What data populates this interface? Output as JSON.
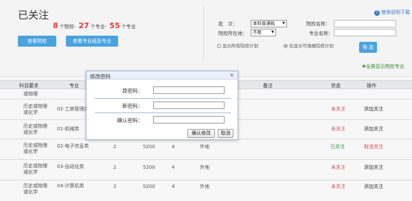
{
  "header": {
    "title": "已关注",
    "counts": {
      "schools": "8",
      "schools_unit": "个院校-",
      "majors": "27",
      "majors_unit": "个专业-",
      "majors2": "55",
      "majors2_unit": "个专业"
    },
    "btn_view_schools": "查看院校",
    "btn_view_majors": "查看专业组及专业"
  },
  "filters": {
    "help": "使用说明下载",
    "batch_label": "批　次：",
    "batch_value": "本科普通批",
    "location_label": "院校所在地：",
    "location_value": "不限",
    "school_name_label": "院校名称：",
    "major_name_label": "专业名称：",
    "radio_all": "显示所有院校计划",
    "radio_fill": "仅显示可填报院校计划",
    "filter_button": "筛 选"
  },
  "fullscreen": "全屏显示院校专业",
  "table": {
    "headers": [
      "科目要求",
      "专业",
      "备注",
      "状态",
      "操作"
    ],
    "rows": [
      {
        "subject": [
          "或物理"
        ],
        "major": "",
        "count": "",
        "plan": "",
        "years": "",
        "location": "",
        "status": "",
        "action": ""
      },
      {
        "subject": [
          "历史或物理",
          "或化学"
        ],
        "major": "02-工商管理类",
        "count": "",
        "plan": "",
        "years": "",
        "location": "",
        "status": "未关注",
        "action": "添加关注"
      },
      {
        "subject": [
          "历史或物理",
          "或化学"
        ],
        "major": "01-机械类",
        "count": "",
        "plan": "",
        "years": "",
        "location": "",
        "status": "未关注",
        "action": "添加关注"
      },
      {
        "subject": [
          "历史或物理",
          "或化学"
        ],
        "major": "02-电子信息类",
        "count": "2",
        "plan": "5200",
        "years": "4",
        "location": "外地",
        "status": "已关注",
        "action": "取消关注"
      },
      {
        "subject": [
          "历史或物理",
          "或化学"
        ],
        "major": "03-自动化类",
        "count": "2",
        "plan": "5200",
        "years": "4",
        "location": "外地",
        "status": "未关注",
        "action": "添加关注"
      },
      {
        "subject": [
          "历史或物理",
          "或化学"
        ],
        "major": "04-计算机类",
        "count": "2",
        "plan": "5200",
        "years": "4",
        "location": "外地",
        "status": "未关注",
        "action": "添加关注"
      }
    ]
  },
  "modal": {
    "title": "修改密码",
    "old_label": "原密码：",
    "new_label": "新密码：",
    "confirm_label": "确认密码：",
    "confirm_button": "确认修改",
    "cancel_button": "取消"
  }
}
